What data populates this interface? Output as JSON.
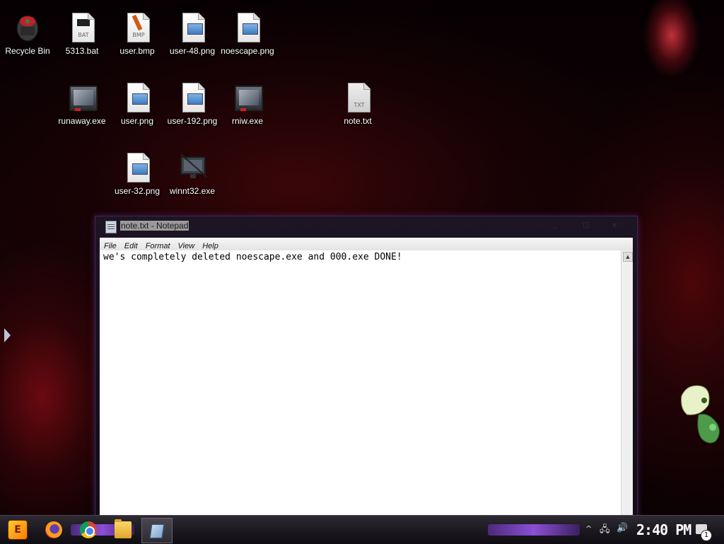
{
  "desktop": {
    "icons": [
      {
        "label": "Recycle Bin",
        "icon": "recycle-bin-icon"
      },
      {
        "label": "5313.bat",
        "icon": "bat-file-icon",
        "tag": "BAT"
      },
      {
        "label": "user.bmp",
        "icon": "bmp-file-icon",
        "tag": "BMP"
      },
      {
        "label": "user-48.png",
        "icon": "image-file-icon"
      },
      {
        "label": "noescape.png",
        "icon": "image-file-icon"
      },
      {
        "label": "runaway.exe",
        "icon": "executable-icon"
      },
      {
        "label": "user.png",
        "icon": "image-file-icon"
      },
      {
        "label": "user-192.png",
        "icon": "image-file-icon"
      },
      {
        "label": "rniw.exe",
        "icon": "executable-icon"
      },
      {
        "label": "note.txt",
        "icon": "text-file-icon",
        "tag": "TXT"
      },
      {
        "label": "user-32.png",
        "icon": "image-file-icon"
      },
      {
        "label": "winnt32.exe",
        "icon": "setup-monitor-icon"
      }
    ]
  },
  "notepad": {
    "title": "note.txt - Notepad",
    "menu": [
      "File",
      "Edit",
      "Format",
      "View",
      "Help"
    ],
    "content": "we's completely deleted noescape.exe and 000.exe DONE!",
    "minimize_glyph": "_",
    "maximize_glyph": "□",
    "close_glyph": "×"
  },
  "taskbar": {
    "pinned": [
      "firefox-icon",
      "chrome-icon",
      "file-explorer-icon"
    ],
    "running": [
      "notepad-icon"
    ],
    "tray": {
      "network_glyph": "🖧",
      "volume_glyph": "🔊",
      "chevron_glyph": "^",
      "clock": "2:40 PM",
      "notification_count": "1"
    },
    "start_glyph": "E"
  }
}
